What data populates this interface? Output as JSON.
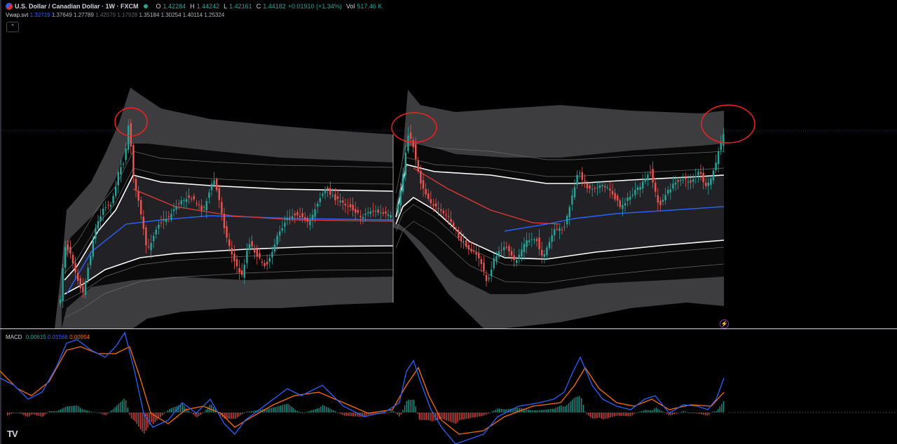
{
  "legend": {
    "symbol_title": "U.S. Dollar / Canadian Dollar · 1W · FXCM",
    "ohlc": [
      {
        "k": "O",
        "v": "1.42284"
      },
      {
        "k": "H",
        "v": "1.44242"
      },
      {
        "k": "L",
        "v": "1.42161"
      },
      {
        "k": "C",
        "v": "1.44182"
      }
    ],
    "change": "+0.01910 (+1.34%)",
    "volume_label": "Vol",
    "volume": "517.46 K"
  },
  "vwap": {
    "name": "Vwap.svt",
    "values": [
      "1.32719",
      "1.37649",
      "1.27789",
      "1.42579",
      "1.17928",
      "1.35184",
      "1.30254",
      "1.40114",
      "1.25324"
    ]
  },
  "macd": {
    "name": "MACD",
    "histogram": "0.00615",
    "macd_line": "0.01568",
    "signal_line": "0.00954"
  },
  "icons": {
    "collapse": "chevron-up-icon",
    "logo": "tradingview-logo",
    "alert": "lightning-icon"
  },
  "logo_text": "TV",
  "colors": {
    "up": "#26a69a",
    "down": "#ef5350",
    "vwap": "#2962ff",
    "anchor": "#e53935",
    "band": "#ffffff",
    "macd_line": "#2962ff",
    "signal_line": "#ff6d00",
    "annotation": "#ff1e1e"
  }
}
